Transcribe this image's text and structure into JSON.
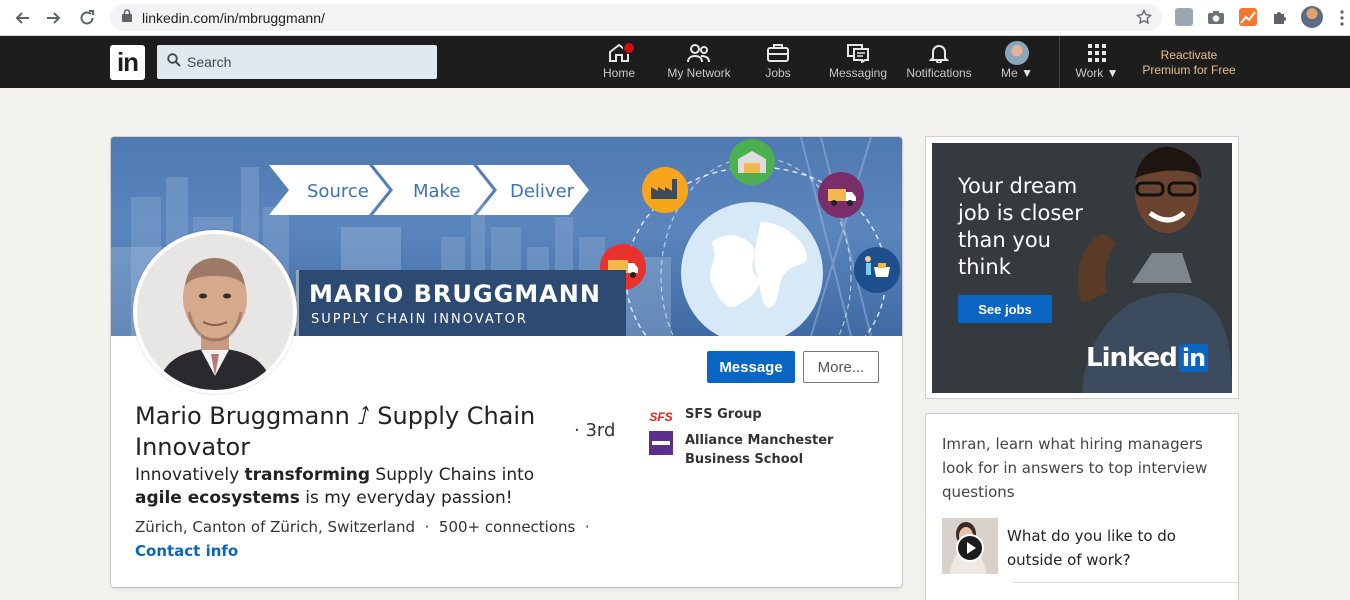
{
  "browser": {
    "url": "linkedin.com/in/mbruggmann/"
  },
  "header": {
    "search_placeholder": "Search",
    "nav": [
      {
        "label": "Home"
      },
      {
        "label": "My Network"
      },
      {
        "label": "Jobs"
      },
      {
        "label": "Messaging"
      },
      {
        "label": "Notifications"
      },
      {
        "label": "Me"
      },
      {
        "label": "Work"
      }
    ],
    "premium_line1": "Reactivate",
    "premium_line2": "Premium for Free",
    "colors": {
      "bar": "#1d1d1d",
      "notification_badge": "#cc1016",
      "premium": "#e7c08c"
    }
  },
  "banner": {
    "steps": [
      "Source",
      "Make",
      "Deliver"
    ],
    "name": "MARIO BRUGGMANN",
    "role": "SUPPLY CHAIN INNOVATOR"
  },
  "profile": {
    "name": "Mario Bruggmann ⭜ Supply Chain Innovator",
    "degree": "· 3rd",
    "headline_parts": {
      "p1": "Innovatively ",
      "b1": "transforming",
      "p2": " Supply Chains into ",
      "b2": "agile ecosystems",
      "p3": " is my everyday passion!"
    },
    "location": "Zürich, Canton of Zürich, Switzerland",
    "connections": "500+ connections",
    "contact_info": "Contact info",
    "message_button": "Message",
    "more_button": "More...",
    "experience": [
      {
        "name": "SFS Group",
        "logo_text": "SFS"
      },
      {
        "name": "Alliance Manchester Business School"
      }
    ]
  },
  "ad": {
    "text": "Your dream job is closer than you think",
    "button": "See jobs",
    "brand": "Linked",
    "brand_in": "in"
  },
  "hiring": {
    "text": "Imran, learn what hiring managers look for in answers to top interview questions",
    "question": "What do you like to do outside of work?"
  }
}
